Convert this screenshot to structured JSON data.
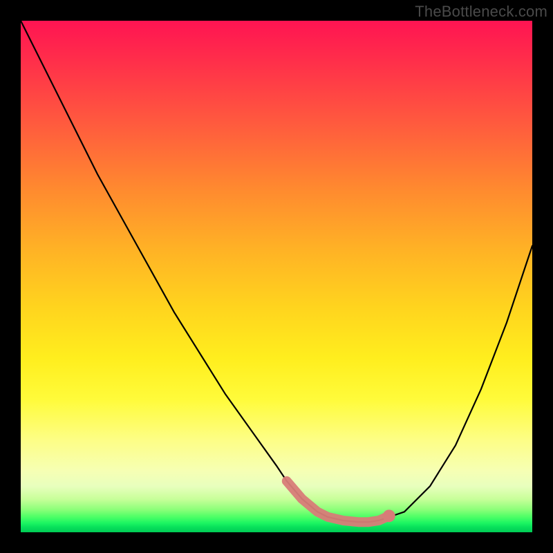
{
  "watermark": "TheBottleneck.com",
  "colors": {
    "curve_stroke": "#000000",
    "accent_stroke": "#d87c78",
    "accent_fill": "#d87c78"
  },
  "chart_data": {
    "type": "line",
    "title": "",
    "xlabel": "",
    "ylabel": "",
    "xlim": [
      0,
      100
    ],
    "ylim": [
      0,
      100
    ],
    "grid": false,
    "legend": false,
    "series": [
      {
        "name": "bottleneck-curve",
        "x": [
          0,
          5,
          10,
          15,
          20,
          25,
          30,
          35,
          40,
          45,
          50,
          52,
          55,
          58,
          60,
          63,
          66,
          68,
          70,
          75,
          80,
          85,
          90,
          95,
          100
        ],
        "y": [
          100,
          90,
          80,
          70,
          61,
          52,
          43,
          35,
          27,
          20,
          13,
          10,
          6.5,
          4,
          3,
          2.3,
          2,
          2,
          2.3,
          4,
          9,
          17,
          28,
          41,
          56
        ]
      }
    ],
    "highlight": {
      "name": "optimal-range",
      "x_range": [
        52,
        72
      ],
      "points": [
        {
          "x": 52,
          "y": 10
        },
        {
          "x": 55,
          "y": 6.5
        },
        {
          "x": 58,
          "y": 4
        },
        {
          "x": 60,
          "y": 3
        },
        {
          "x": 63,
          "y": 2.3
        },
        {
          "x": 66,
          "y": 2
        },
        {
          "x": 68,
          "y": 2
        },
        {
          "x": 70,
          "y": 2.3
        },
        {
          "x": 72,
          "y": 3.2
        }
      ],
      "marker_at": {
        "x": 72,
        "y": 3.2
      }
    }
  }
}
